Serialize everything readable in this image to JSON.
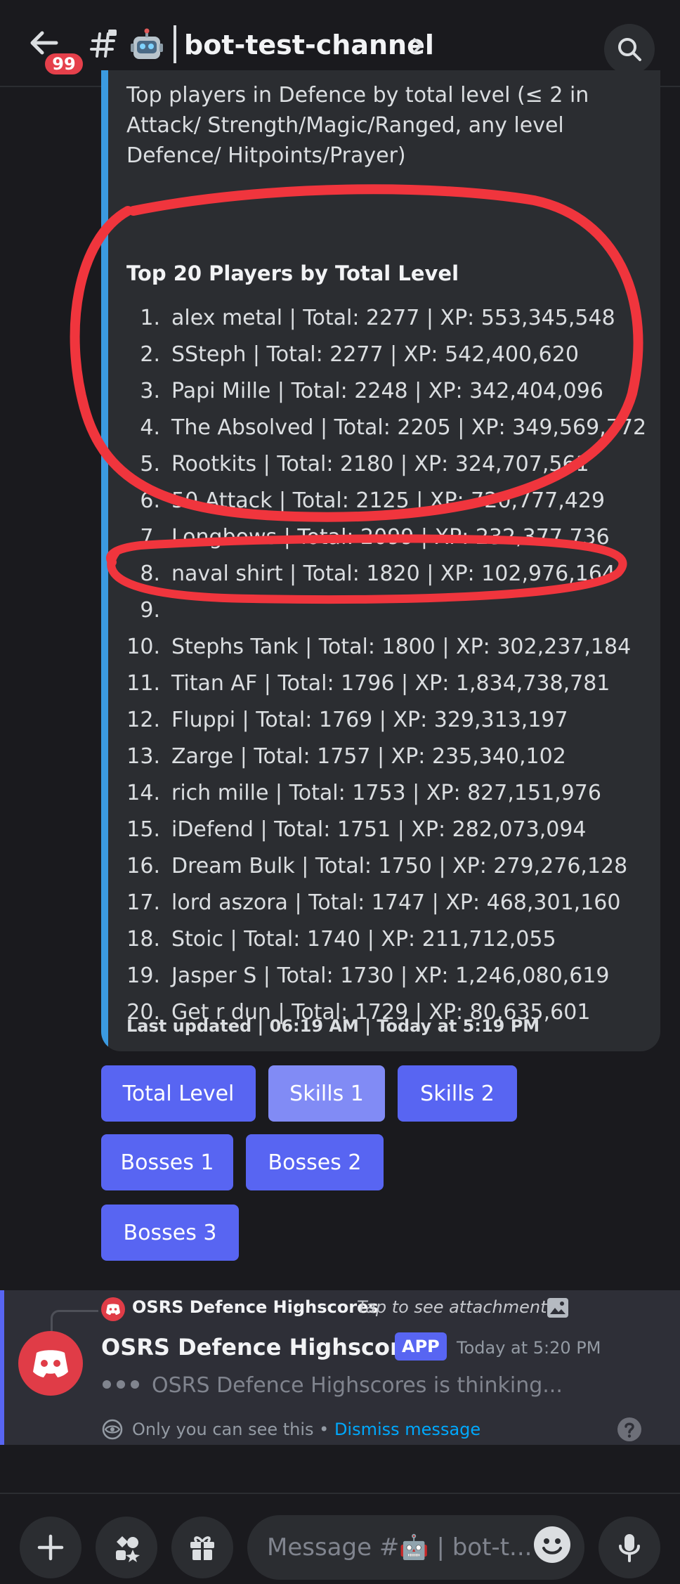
{
  "header": {
    "unread_badge": "99",
    "channel_emoji": "🤖",
    "channel_name": "bot-test-channel"
  },
  "embed": {
    "description": "Top players in Defence by total level (≤ 2 in Attack/ Strength/Magic/Ranged, any level Defence/ Hitpoints/Prayer)",
    "title": "Top 20 Players by Total Level",
    "rows": [
      {
        "rank": "1.",
        "text": "alex metal | Total: 2277 | XP: 553,345,548"
      },
      {
        "rank": "2.",
        "text": "SSteph | Total: 2277 | XP: 542,400,620"
      },
      {
        "rank": "3.",
        "text": "Papi Mille | Total: 2248 | XP: 342,404,096"
      },
      {
        "rank": "4.",
        "text": "The Absolved | Total: 2205 | XP: 349,569,772"
      },
      {
        "rank": "5.",
        "text": "Rootkits | Total: 2180 | XP: 324,707,561"
      },
      {
        "rank": "6.",
        "text": "50 Attack | Total: 2125 | XP: 720,777,429"
      },
      {
        "rank": "7.",
        "text": "Longbows | Total: 2099 | XP: 232,377,736"
      },
      {
        "rank": "8.",
        "text": "naval shirt | Total: 1820 | XP: 102,976,164"
      },
      {
        "rank": "9.",
        "text": ""
      },
      {
        "rank": "10.",
        "text": "Stephs Tank | Total: 1800 | XP: 302,237,184"
      },
      {
        "rank": "11.",
        "text": "Titan AF | Total: 1796 | XP: 1,834,738,781"
      },
      {
        "rank": "12.",
        "text": "Fluppi | Total: 1769 | XP: 329,313,197"
      },
      {
        "rank": "13.",
        "text": "Zarge | Total: 1757 | XP: 235,340,102"
      },
      {
        "rank": "14.",
        "text": "rich mille | Total: 1753 | XP: 827,151,976"
      },
      {
        "rank": "15.",
        "text": "iDefend | Total: 1751 | XP: 282,073,094"
      },
      {
        "rank": "16.",
        "text": "Dream Bulk | Total: 1750 | XP: 279,276,128"
      },
      {
        "rank": "17.",
        "text": "lord aszora | Total: 1747 | XP: 468,301,160"
      },
      {
        "rank": "18.",
        "text": "Stoic | Total: 1740 | XP: 211,712,055"
      },
      {
        "rank": "19.",
        "text": "Jasper S | Total: 1730 | XP: 1,246,080,619"
      },
      {
        "rank": "20.",
        "text": "Get r dun | Total: 1729 | XP: 80,635,601"
      }
    ],
    "footer": "Last updated | 06:19 AM | Today at 5:19 PM",
    "accent_color": "#3b9ae0"
  },
  "buttons": {
    "total_level": "Total Level",
    "skills_1": "Skills 1",
    "skills_2": "Skills 2",
    "bosses_1": "Bosses 1",
    "bosses_2": "Bosses 2",
    "bosses_3": "Bosses 3",
    "selected": "Skills 1"
  },
  "ephemeral": {
    "reply_author": "OSRS Defence Highscores",
    "reply_note": "Tap to see attachment",
    "author": "OSRS Defence Highscores",
    "app_tag": "APP",
    "timestamp": "Today at 5:20 PM",
    "thinking": "OSRS Defence Highscores is thinking...",
    "only_you": "Only you can see this • ",
    "dismiss": "Dismiss message"
  },
  "composer": {
    "placeholder": "Message #🤖 | bot-t..."
  },
  "colors": {
    "blurple": "#5865f2",
    "annotation_red": "#f0353d"
  }
}
